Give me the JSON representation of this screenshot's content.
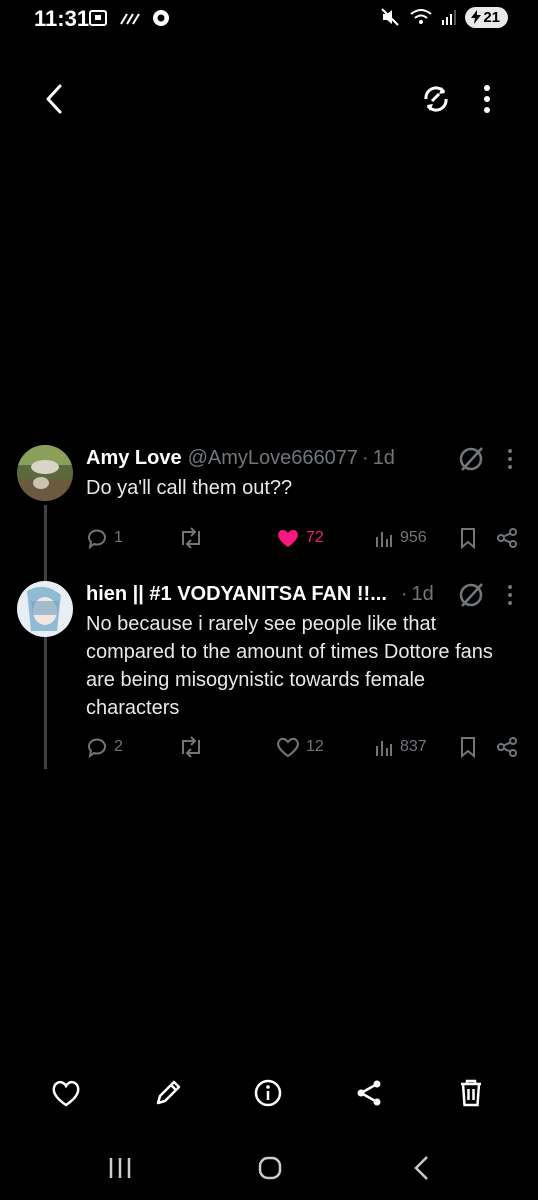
{
  "status_bar": {
    "time": "11:31",
    "battery": "21"
  },
  "tweets": [
    {
      "name": "Amy Love",
      "handle": "@AmyLove666077",
      "dot": "·",
      "time": "1d",
      "text": "Do ya'll call them out??",
      "replies": "1",
      "reposts": "",
      "likes": "72",
      "liked": true,
      "views": "956"
    },
    {
      "name": "hien || #1 VODYANITSA FAN !!...",
      "handle": "",
      "dot": "·",
      "time": "1d",
      "text": "No because i rarely see people like that compared to the amount of times Dottore fans are being misogynistic towards female characters",
      "replies": "2",
      "reposts": "",
      "likes": "12",
      "liked": false,
      "views": "837"
    }
  ],
  "colors": {
    "background": "#000000",
    "text": "#e7e9ea",
    "muted": "#71767b",
    "like": "#f91880"
  },
  "icons": {
    "header": [
      "back-arrow-icon",
      "refresh-icon",
      "more-vertical-icon"
    ],
    "actions": [
      "reply-icon",
      "repost-icon",
      "heart-icon",
      "views-icon",
      "bookmark-icon",
      "share-icon"
    ],
    "bottom_bar": [
      "heart-outline-icon",
      "pencil-icon",
      "info-icon",
      "share-nodes-icon",
      "trash-icon"
    ],
    "nav": [
      "recent-apps-icon",
      "home-icon",
      "back-icon"
    ]
  }
}
